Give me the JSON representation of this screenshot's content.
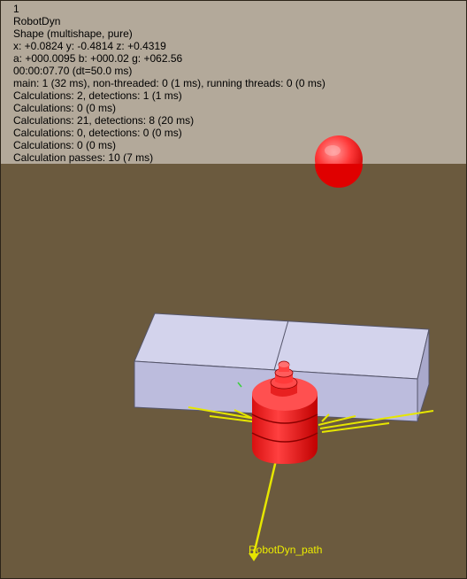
{
  "viewport": {
    "info_lines": [
      "1",
      "RobotDyn",
      "Shape (multishape, pure)",
      "x: +0.0824    y: -0.4814    z: +0.4319",
      "a: +000.0095    b: +000.02    g: +062.56",
      "00:00:07.70 (dt=50.0 ms)",
      "main: 1 (32 ms), non-threaded: 0 (1 ms), running threads: 0 (0 ms)",
      "Calculations: 2, detections: 1 (1 ms)",
      "Calculations: 0 (0 ms)",
      "Calculations: 21, detections: 8 (20 ms)",
      "Calculations: 0, detections: 0 (0 ms)",
      "Calculations: 0 (0 ms)",
      "Calculation passes: 10 (7 ms)"
    ],
    "path_label": "RobotDyn_path"
  },
  "colors": {
    "floor": "#6b5a3e",
    "background_band": "#b3a99a",
    "box_top": "#d2d2ec",
    "box_front": "#b9b9dc",
    "robot_red": "#ff2a2a",
    "sphere_red": "#e60000",
    "path_yellow": "#e6e600"
  }
}
